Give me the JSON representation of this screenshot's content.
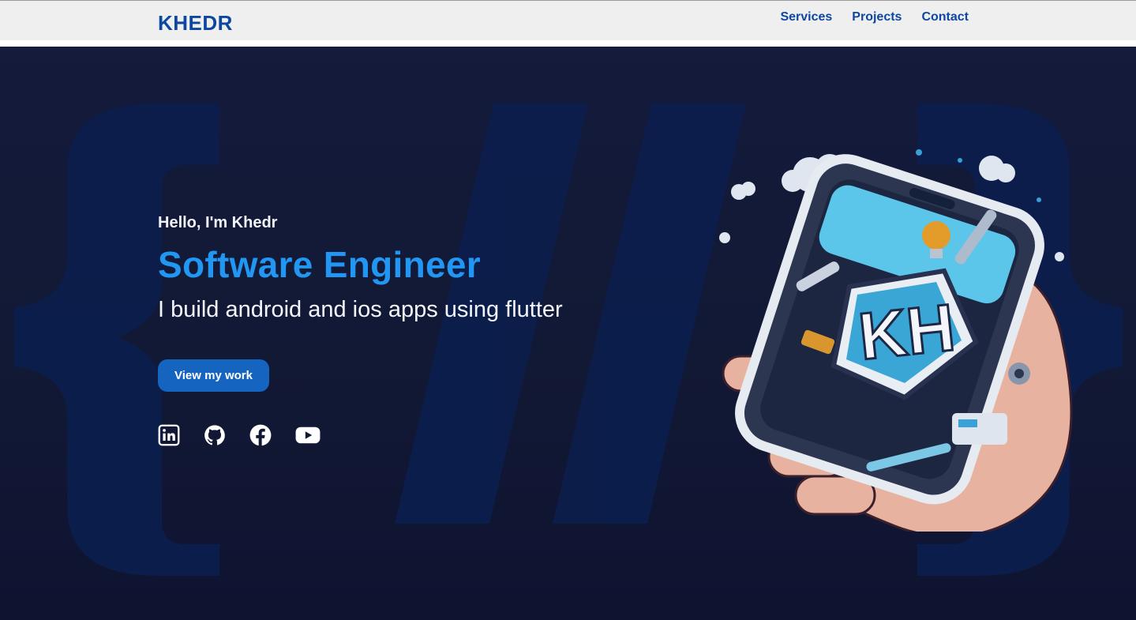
{
  "header": {
    "logo": "KHEDR",
    "nav": [
      {
        "label": "Services"
      },
      {
        "label": "Projects"
      },
      {
        "label": "Contact"
      }
    ]
  },
  "hero": {
    "greeting": "Hello, I'm Khedr",
    "role": "Software Engineer",
    "tagline": "I build android and ios apps using flutter",
    "cta_label": "View my work",
    "background_glyphs": "{//}",
    "illustration_monogram": "KH"
  },
  "socials": [
    {
      "icon": "linkedin-icon"
    },
    {
      "icon": "github-icon"
    },
    {
      "icon": "facebook-icon"
    },
    {
      "icon": "youtube-icon"
    }
  ],
  "colors": {
    "brand_blue": "#0d47a1",
    "accent_blue": "#2196f3",
    "button_blue": "#1565c0",
    "hero_background": "#121935",
    "header_background": "#efefef"
  }
}
